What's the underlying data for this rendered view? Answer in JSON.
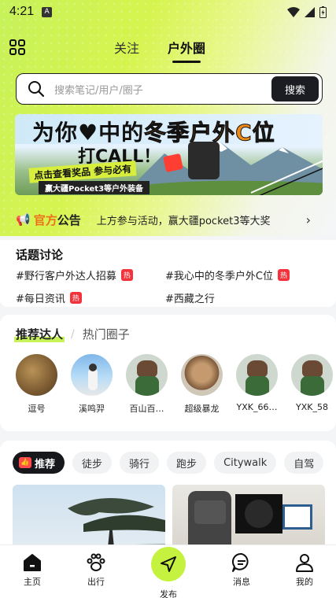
{
  "status": {
    "time": "4:21",
    "a_label": "A"
  },
  "tabs": {
    "follow": "关注",
    "outdoor": "户外圈"
  },
  "search": {
    "placeholder": "搜索笔记/用户/圈子",
    "button": "搜索"
  },
  "banner": {
    "headline_a": "为你♥中的",
    "headline_b": "冬季户外C位",
    "call": "打CALL！",
    "sub": "点击查看奖品  参与必有",
    "prize": "赢大疆Pocket3等户外装备"
  },
  "notice": {
    "title_a": "官方",
    "title_b": "公告",
    "text": "上方参与活动，赢大疆pocket3等大奖",
    "chevron": "›"
  },
  "topics": {
    "title": "话题讨论",
    "items": [
      {
        "label": "#野行客户外达人招募",
        "hot": "热"
      },
      {
        "label": "#我心中的冬季户外C位",
        "hot": "热"
      },
      {
        "label": "#每日资讯",
        "hot": "热"
      },
      {
        "label": "#西藏之行",
        "hot": ""
      }
    ]
  },
  "recommend": {
    "tab_active": "推荐达人",
    "separator": "/",
    "tab_inactive": "热门圈子",
    "users": [
      {
        "name": "逗号"
      },
      {
        "name": "溪鸣羿"
      },
      {
        "name": "百山百…"
      },
      {
        "name": "超级暴龙"
      },
      {
        "name": "YXK_66…"
      },
      {
        "name": "YXK_58"
      }
    ]
  },
  "filters": {
    "active": "推荐",
    "items": [
      "徒步",
      "骑行",
      "跑步",
      "Citywalk",
      "自驾"
    ]
  },
  "nav": {
    "home": "主页",
    "travel": "出行",
    "publish": "发布",
    "messages": "消息",
    "mine": "我的"
  }
}
